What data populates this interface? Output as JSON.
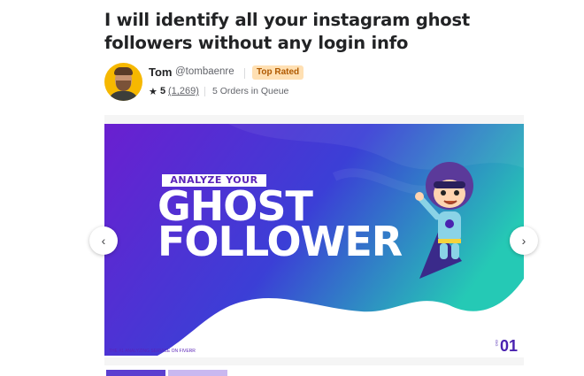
{
  "gig": {
    "title": "I will identify all your instagram ghost followers without any login info"
  },
  "seller": {
    "name": "Tom",
    "handle": "@tombaenre",
    "badge": "Top Rated",
    "rating": "5",
    "reviews": "(1,269)",
    "queue": "5 Orders in Queue"
  },
  "slide": {
    "tag": "ANALYZE YOUR",
    "line1": "GHOST",
    "line2": "FOLLOWER",
    "footer": "THE #1 ANALYZING SERVICE ON FIVERR",
    "number": "01",
    "number_tag": "GIG"
  },
  "nav": {
    "prev": "‹",
    "next": "›"
  },
  "colors": {
    "brand_purple": "#4a22b0",
    "badge_bg": "#ffe0b3",
    "badge_text": "#b05a00"
  }
}
